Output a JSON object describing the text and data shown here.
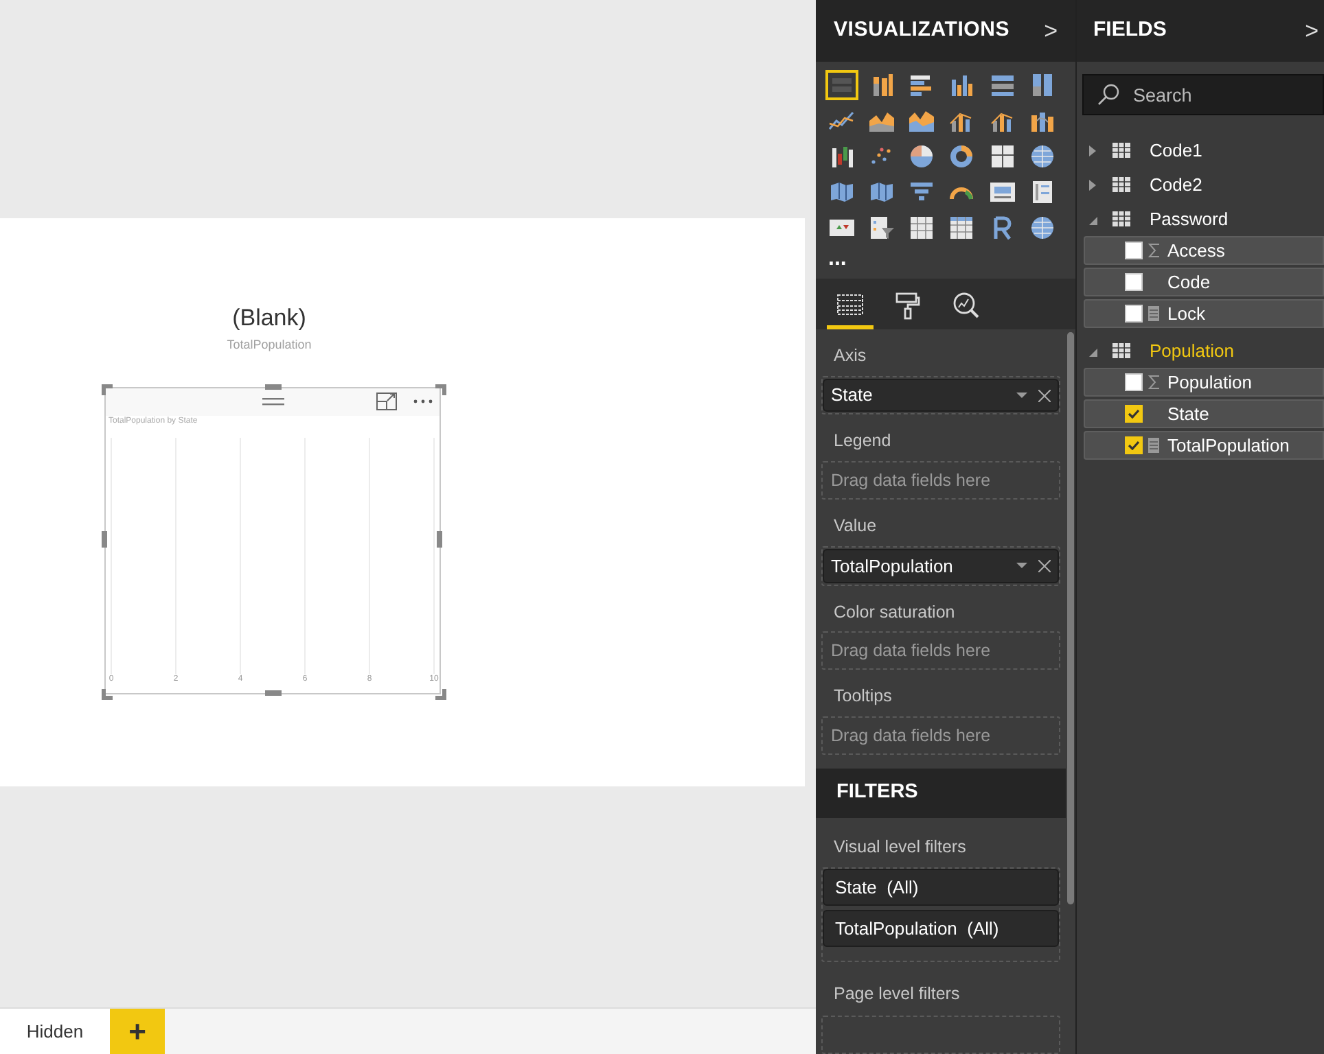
{
  "canvas": {
    "card": {
      "value": "(Blank)",
      "label": "TotalPopulation"
    },
    "visual": {
      "title": "TotalPopulation by State",
      "axis_labels": [
        "0",
        "2",
        "4",
        "6",
        "8",
        "10"
      ]
    }
  },
  "page_tabs": [
    {
      "label": "Hidden",
      "selected": true
    }
  ],
  "add_page_button": "+",
  "visualizations": {
    "title": "VISUALIZATIONS",
    "collapse": ">",
    "gallery": [
      {
        "kind": "stacked-bar",
        "selected": true
      },
      {
        "kind": "stacked-column",
        "selected": false
      },
      {
        "kind": "clustered-bar",
        "selected": false
      },
      {
        "kind": "clustered-column",
        "selected": false
      },
      {
        "kind": "full-bar",
        "selected": false
      },
      {
        "kind": "full-column",
        "selected": false
      },
      {
        "kind": "line",
        "selected": false
      },
      {
        "kind": "area",
        "selected": false
      },
      {
        "kind": "stacked-area",
        "selected": false
      },
      {
        "kind": "line-column",
        "selected": false
      },
      {
        "kind": "line-column",
        "selected": false
      },
      {
        "kind": "ribbon",
        "selected": false
      },
      {
        "kind": "waterfall",
        "selected": false
      },
      {
        "kind": "scatter",
        "selected": false
      },
      {
        "kind": "pie",
        "selected": false
      },
      {
        "kind": "donut",
        "selected": false
      },
      {
        "kind": "treemap",
        "selected": false
      },
      {
        "kind": "globe",
        "selected": false
      },
      {
        "kind": "map",
        "selected": false
      },
      {
        "kind": "map",
        "selected": false
      },
      {
        "kind": "funnel",
        "selected": false
      },
      {
        "kind": "gauge",
        "selected": false
      },
      {
        "kind": "card",
        "selected": false
      },
      {
        "kind": "multirow",
        "selected": false
      },
      {
        "kind": "kpi",
        "selected": false
      },
      {
        "kind": "slicer",
        "selected": false
      },
      {
        "kind": "table",
        "selected": false
      },
      {
        "kind": "matrix",
        "selected": false
      },
      {
        "kind": "r",
        "selected": false
      },
      {
        "kind": "globe",
        "selected": false
      }
    ],
    "more": "...",
    "tabs": [
      {
        "kind": "fields",
        "selected": true
      },
      {
        "kind": "format",
        "selected": false
      },
      {
        "kind": "analytics",
        "selected": false
      }
    ],
    "wells": [
      {
        "label": "Axis",
        "fields": [
          "State"
        ]
      },
      {
        "label": "Legend",
        "placeholder": "Drag data fields here"
      },
      {
        "label": "Value",
        "fields": [
          "TotalPopulation"
        ]
      },
      {
        "label": "Color saturation",
        "placeholder": "Drag data fields here"
      },
      {
        "label": "Tooltips",
        "placeholder": "Drag data fields here"
      }
    ]
  },
  "filters": {
    "title": "FILTERS",
    "visual_level": {
      "label": "Visual level filters",
      "items": [
        "State  (All)",
        "TotalPopulation  (All)"
      ]
    },
    "page_level": {
      "label": "Page level filters"
    }
  },
  "fields": {
    "title": "FIELDS",
    "collapse": ">",
    "search": {
      "placeholder": "Search"
    },
    "tables": [
      {
        "name": "Code1",
        "expanded": false,
        "highlighted": false
      },
      {
        "name": "Code2",
        "expanded": false,
        "highlighted": false
      },
      {
        "name": "Password",
        "expanded": true,
        "highlighted": false,
        "children": [
          {
            "name": "Access",
            "kind": "sum",
            "checked": false
          },
          {
            "name": "Code",
            "kind": "plain",
            "checked": false
          },
          {
            "name": "Lock",
            "kind": "measure",
            "checked": false
          }
        ]
      },
      {
        "name": "Population",
        "expanded": true,
        "highlighted": true,
        "children": [
          {
            "name": "Population",
            "kind": "sum",
            "checked": false
          },
          {
            "name": "State",
            "kind": "plain",
            "checked": true
          },
          {
            "name": "TotalPopulation",
            "kind": "measure",
            "checked": true
          }
        ]
      }
    ]
  }
}
